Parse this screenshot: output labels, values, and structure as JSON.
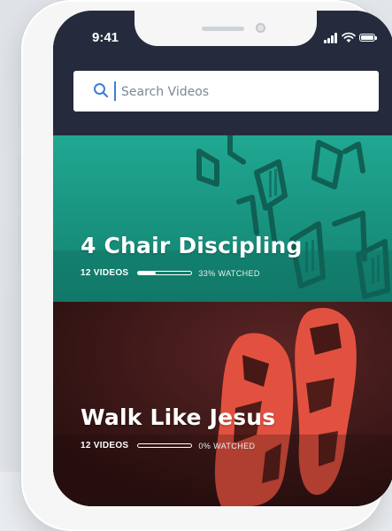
{
  "status_bar": {
    "time": "9:41"
  },
  "search": {
    "placeholder": "Search Videos",
    "value": ""
  },
  "series": [
    {
      "title": "4 Chair Discipling",
      "video_count": "12 VIDEOS",
      "watched_label": "33% WATCHED",
      "watched_fraction": 0.33
    },
    {
      "title": "Walk Like Jesus",
      "video_count": "12 VIDEOS",
      "watched_label": "0% WATCHED",
      "watched_fraction": 0.0
    }
  ],
  "colors": {
    "header_bg": "#252b3d",
    "card1_bg": "#1a9a87",
    "card2_bg": "#3a1818",
    "card2_art": "#e2513f",
    "search_accent": "#3c7fd2"
  },
  "icons": [
    "signal-icon",
    "wifi-icon",
    "battery-icon",
    "search-icon"
  ]
}
